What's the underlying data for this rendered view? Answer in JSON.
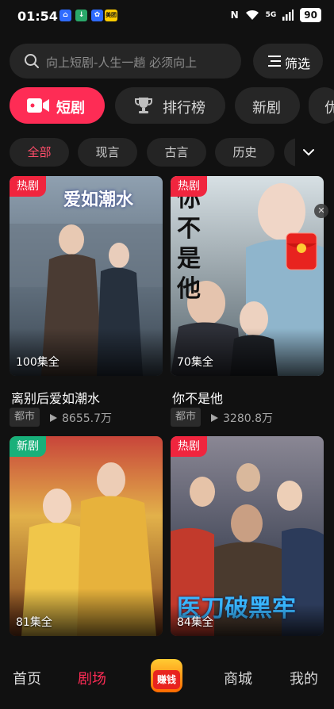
{
  "status": {
    "time": "01:54",
    "notifications": [
      {
        "icon": "taobao-icon",
        "glyph": "⌂",
        "color": "#2f6bff"
      },
      {
        "icon": "download-icon",
        "glyph": "↓",
        "color": "#2aa86a"
      },
      {
        "icon": "app-icon",
        "glyph": "✿",
        "color": "#2f6bff"
      },
      {
        "icon": "meituan-icon",
        "glyph": "美团",
        "color": "#ffcc00"
      }
    ],
    "network": "5G",
    "battery": "90"
  },
  "search": {
    "placeholder": "向上短剧-人生一趟 必须向上"
  },
  "filter": {
    "label": "筛选"
  },
  "tabs": [
    {
      "label": "短剧",
      "icon": "video-camera-icon",
      "active": true
    },
    {
      "label": "排行榜",
      "icon": "trophy-icon",
      "active": false
    },
    {
      "label": "新剧",
      "active": false
    },
    {
      "label": "优",
      "active": false
    }
  ],
  "genres": [
    {
      "label": "全部",
      "active": true
    },
    {
      "label": "现言",
      "active": false
    },
    {
      "label": "古言",
      "active": false
    },
    {
      "label": "历史",
      "active": false
    }
  ],
  "cards": [
    {
      "badge": "热剧",
      "badge_type": "hot",
      "poster_text": "爱如潮水",
      "episodes": "100集全",
      "title": "离别后爱如潮水",
      "tag": "都市",
      "plays": "8655.7万",
      "palette": [
        "#7a8b9a",
        "#3d4a57"
      ]
    },
    {
      "badge": "热剧",
      "badge_type": "hot",
      "poster_text": "你不是他",
      "episodes": "70集全",
      "title": "你不是他",
      "tag": "都市",
      "plays": "3280.8万",
      "palette": [
        "#c7d3d8",
        "#5b6b74"
      ]
    },
    {
      "badge": "新剧",
      "badge_type": "new",
      "poster_text": "",
      "episodes": "81集全",
      "title": "",
      "tag": "",
      "plays": "",
      "palette": [
        "#d9a441",
        "#8a3b1c"
      ]
    },
    {
      "badge": "热剧",
      "badge_type": "hot",
      "poster_text": "医刀破黑牢",
      "episodes": "84集全",
      "title": "",
      "tag": "",
      "plays": "",
      "palette": [
        "#6f6a78",
        "#1e2a40"
      ]
    }
  ],
  "nav": [
    {
      "label": "首页",
      "active": false
    },
    {
      "label": "剧场",
      "active": true
    },
    {
      "label": "赚钱",
      "active": false
    },
    {
      "label": "商城",
      "active": false
    },
    {
      "label": "我的",
      "active": false
    }
  ],
  "colors": {
    "accent": "#fe2c55",
    "hot": "#f0253e",
    "new": "#18b07a",
    "bg": "#111111"
  }
}
